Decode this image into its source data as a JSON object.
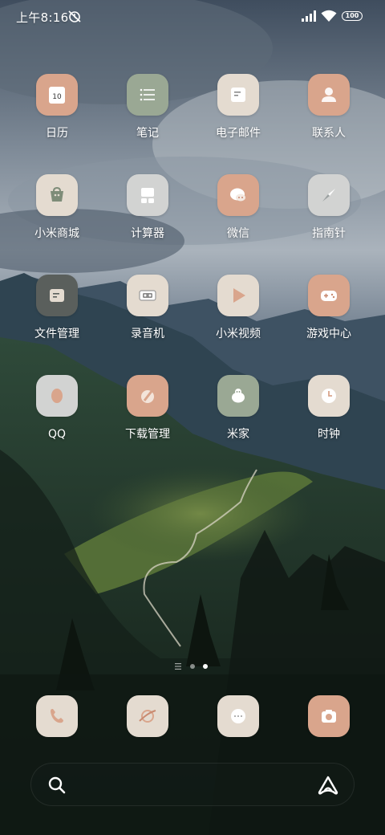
{
  "status_bar": {
    "time": "上午8:16",
    "battery": "100",
    "icons": [
      "alarm-off-icon",
      "cellular-signal-icon",
      "wifi-icon",
      "battery-icon"
    ]
  },
  "apps": [
    {
      "label": "日历",
      "icon": "calendar-icon",
      "bg": "#D9A58C",
      "badge": "10"
    },
    {
      "label": "笔记",
      "icon": "notes-icon",
      "bg": "#9AA894"
    },
    {
      "label": "电子邮件",
      "icon": "email-icon",
      "bg": "#E4DBD0"
    },
    {
      "label": "联系人",
      "icon": "contacts-icon",
      "bg": "#D9A58C"
    },
    {
      "label": "小米商城",
      "icon": "mi-store-icon",
      "bg": "#E4DBD0"
    },
    {
      "label": "计算器",
      "icon": "calculator-icon",
      "bg": "#D2D3D2"
    },
    {
      "label": "微信",
      "icon": "wechat-icon",
      "bg": "#D9A58C"
    },
    {
      "label": "指南针",
      "icon": "compass-icon",
      "bg": "#D2D3D2"
    },
    {
      "label": "文件管理",
      "icon": "file-manager-icon",
      "bg": "#5A5F5C"
    },
    {
      "label": "录音机",
      "icon": "recorder-icon",
      "bg": "#E4DBD0"
    },
    {
      "label": "小米视频",
      "icon": "video-play-icon",
      "bg": "#E4DBD0"
    },
    {
      "label": "游戏中心",
      "icon": "game-center-icon",
      "bg": "#D9A58C"
    },
    {
      "label": "QQ",
      "icon": "qq-icon",
      "bg": "#D2D3D2"
    },
    {
      "label": "下载管理",
      "icon": "download-manager-icon",
      "bg": "#D9A58C"
    },
    {
      "label": "米家",
      "icon": "mi-home-icon",
      "bg": "#9AA894"
    },
    {
      "label": "时钟",
      "icon": "clock-icon",
      "bg": "#E4DBD0"
    }
  ],
  "dock": [
    {
      "icon": "phone-icon",
      "bg": "#E4DBD0"
    },
    {
      "icon": "browser-icon",
      "bg": "#E4DBD0"
    },
    {
      "icon": "messages-icon",
      "bg": "#E4DBD0"
    },
    {
      "icon": "camera-icon",
      "bg": "#D9A58C"
    }
  ],
  "page_indicator": {
    "pages": 3,
    "current": 3
  },
  "search_bar": {
    "icons": [
      "search-icon",
      "xiaoai-assistant-icon"
    ]
  },
  "colors": {
    "peach": "#D9A58C",
    "sage": "#9AA894",
    "cream": "#E4DBD0",
    "light_gray": "#D2D3D2",
    "dark_gray": "#5A5F5C",
    "glyph_peach": "#C98A70",
    "glyph_sage": "#7E8C78"
  }
}
